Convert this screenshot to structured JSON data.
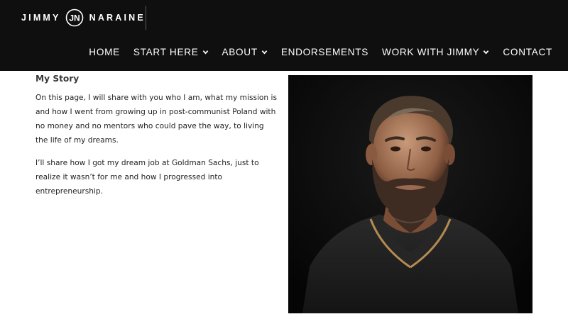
{
  "header": {
    "logo": {
      "left_word": "JIMMY",
      "right_word": "NARAINE",
      "monogram": "JN"
    },
    "nav": [
      {
        "label": "HOME",
        "has_dropdown": false
      },
      {
        "label": "START HERE",
        "has_dropdown": true
      },
      {
        "label": "ABOUT",
        "has_dropdown": true
      },
      {
        "label": "ENDORSEMENTS",
        "has_dropdown": false
      },
      {
        "label": "WORK WITH JIMMY",
        "has_dropdown": true
      },
      {
        "label": "CONTACT",
        "has_dropdown": false
      }
    ]
  },
  "main": {
    "title": "My Story",
    "paragraphs": [
      "On this page, I will share with you who I am, what my mission is and how I went from growing up in post-communist Poland with no money and no mentors who could pave the way, to living the life of my dreams.",
      "I’ll share how I got my dream job at Goldman Sachs, just to realize it wasn’t for me and how I progressed into entrepreneurship."
    ],
    "photo": {
      "icon": "portrait-photo-icon"
    }
  },
  "colors": {
    "header_bg": "#0f0f0f",
    "nav_text": "#ffffff",
    "body_text": "#222222"
  }
}
